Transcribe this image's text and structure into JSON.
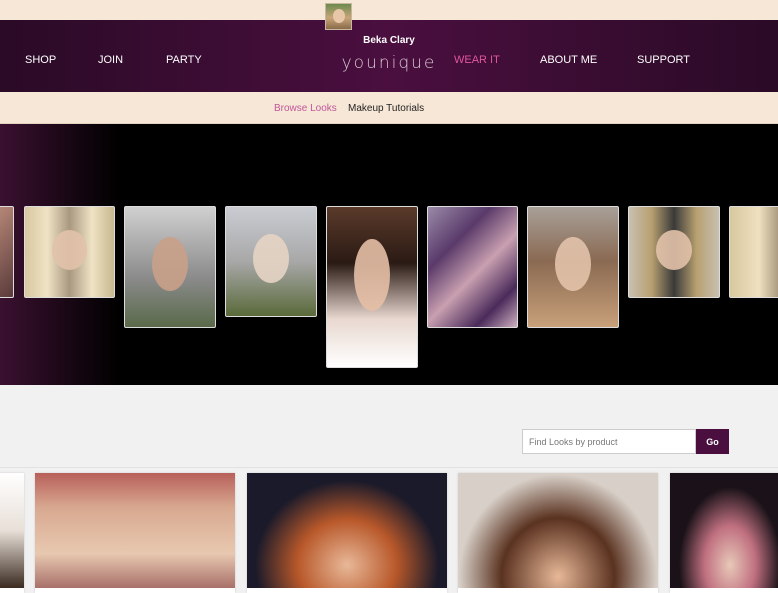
{
  "user": {
    "name": "Beka Clary"
  },
  "brand": {
    "name": "younique"
  },
  "nav": {
    "left": [
      "SHOP",
      "JOIN",
      "PARTY"
    ],
    "right": [
      "WEAR IT",
      "ABOUT ME",
      "SUPPORT"
    ],
    "active": "WEAR IT"
  },
  "subnav": {
    "items": [
      "Browse Looks",
      "Makeup Tutorials"
    ],
    "active": "Browse Looks"
  },
  "colors": {
    "brand_purple": "#4a0f3f",
    "accent_pink": "#e0569a",
    "cream": "#f7e7d7"
  },
  "carousel": {
    "count": 10
  },
  "search": {
    "placeholder": "Find Looks by product",
    "button": "Go"
  },
  "grid": {
    "count": 5
  }
}
